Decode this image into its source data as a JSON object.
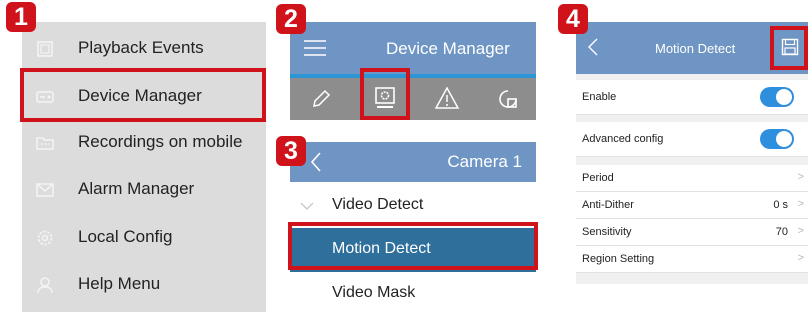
{
  "step_badges": [
    "1",
    "2",
    "3",
    "4"
  ],
  "panel1": {
    "items": [
      {
        "label": "Playback Events",
        "icon": "playback-icon"
      },
      {
        "label": "Device Manager",
        "icon": "device-icon"
      },
      {
        "label": "Recordings on mobile",
        "icon": "folder-icon"
      },
      {
        "label": "Alarm Manager",
        "icon": "alarm-icon"
      },
      {
        "label": "Local Config",
        "icon": "gear-icon"
      },
      {
        "label": "Help Menu",
        "icon": "help-icon"
      }
    ]
  },
  "panel2": {
    "title": "Device Manager",
    "toolbar_icons": [
      "pencil-icon",
      "config-icon",
      "warning-icon",
      "history-icon"
    ]
  },
  "panel3": {
    "title": "Camera 1",
    "group_label": "Video Detect",
    "items": [
      "Motion Detect",
      "Video Mask"
    ]
  },
  "panel4": {
    "title": "Motion Detect",
    "rows": [
      {
        "label": "Enable",
        "toggle": true
      },
      {
        "label": "Advanced config",
        "toggle": true
      },
      {
        "label": "Period",
        "value": ""
      },
      {
        "label": "Anti-Dither",
        "value": "0 s"
      },
      {
        "label": "Sensitivity",
        "value": "70"
      },
      {
        "label": "Region Setting",
        "value": ""
      }
    ]
  },
  "colors": {
    "accent_red": "#d0121b",
    "header_blue": "#6f95c4",
    "selected_blue": "#2e6f9b",
    "toggle_blue": "#2f8fdf"
  }
}
